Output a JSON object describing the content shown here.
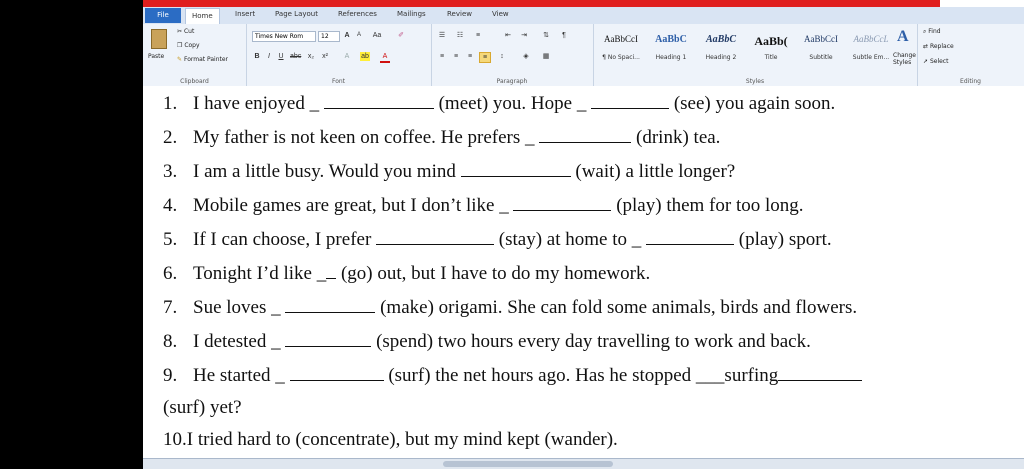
{
  "ribbon_tabs": [
    "File",
    "Home",
    "Insert",
    "Page Layout",
    "References",
    "Mailings",
    "Review",
    "View"
  ],
  "clipboard": {
    "paste": "Paste",
    "cut": "Cut",
    "copy": "Copy",
    "format_painter": "Format Painter",
    "label": "Clipboard"
  },
  "font": {
    "name": "Times New Rom",
    "size": "12",
    "label": "Font"
  },
  "paragraph": {
    "label": "Paragraph"
  },
  "styles": {
    "label": "Styles",
    "items": [
      {
        "sample": "AaBbCcI",
        "name": "¶ No Spaci..."
      },
      {
        "sample": "AaBbC",
        "name": "Heading 1"
      },
      {
        "sample": "AaBbC",
        "name": "Heading 2"
      },
      {
        "sample": "AaBb(",
        "name": "Title"
      },
      {
        "sample": "AaBbCcI",
        "name": "Subtitle"
      },
      {
        "sample": "AaBbCcL",
        "name": "Subtle Em..."
      }
    ],
    "change": "Change Styles"
  },
  "editing": {
    "find": "Find",
    "replace": "Replace",
    "select": "Select",
    "label": "Editing"
  },
  "exercise": [
    {
      "num": "1.",
      "parts": [
        "I have enjoyed _ ",
        "",
        "(meet) you. Hope _ ",
        "",
        "(see) you again soon."
      ]
    },
    {
      "num": "2.",
      "parts": [
        "My father is not keen on coffee. He prefers _ ",
        "",
        "(drink) tea."
      ]
    },
    {
      "num": "3.",
      "parts": [
        "I am a little busy. Would you mind ",
        "",
        "(wait) a little longer?"
      ]
    },
    {
      "num": "4.",
      "parts": [
        "Mobile games are great, but I don’t like _ ",
        "",
        "(play) them for too long."
      ]
    },
    {
      "num": "5.",
      "parts": [
        "If I can choose, I prefer ",
        "",
        "(stay) at home to _ ",
        "",
        "(play) sport."
      ]
    },
    {
      "num": "6.",
      "parts": [
        "Tonight I’d like _",
        "",
        "(go) out, but I have to do my homework."
      ]
    },
    {
      "num": "7.",
      "parts": [
        "Sue loves _ ",
        "",
        "(make) origami. She can fold some animals, birds and flowers."
      ]
    },
    {
      "num": "8.",
      "parts": [
        "I detested _ ",
        "",
        "(spend) two hours every day travelling to work and back."
      ]
    },
    {
      "num": "9.",
      "parts": [
        "He started _ ",
        "",
        "(surf) the net hours ago. Has he stopped ___surfing",
        ""
      ]
    },
    {
      "num": "",
      "parts": [
        "(surf) yet?"
      ]
    },
    {
      "num": "10.",
      "parts": [
        "I tried hard to  (concentrate), but my mind kept                   (wander)."
      ]
    }
  ]
}
